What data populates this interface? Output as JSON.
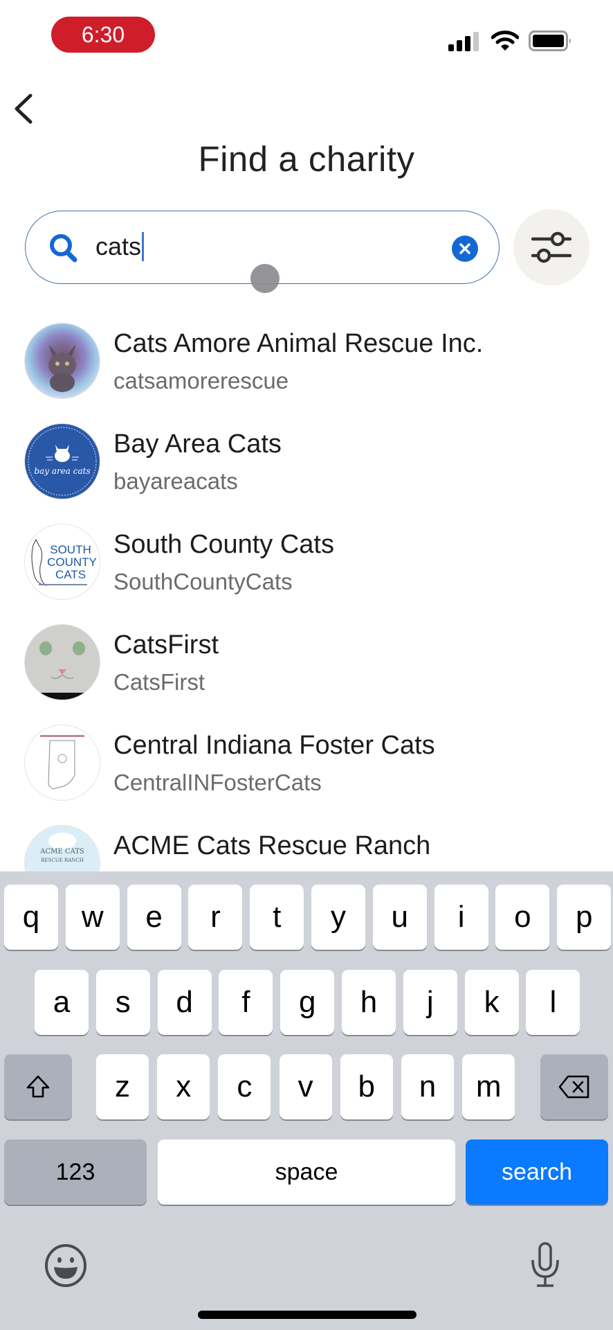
{
  "status_bar": {
    "time": "6:30",
    "time_pill_color": "#cf1d2a",
    "icons": [
      "cellular-signal-icon",
      "wifi-icon",
      "battery-icon"
    ]
  },
  "header": {
    "back_icon": "chevron-left-icon",
    "title": "Find a charity"
  },
  "search": {
    "value": "cats",
    "placeholder": "",
    "icon": "search-icon",
    "clear_icon": "clear-circle-icon",
    "accent_color": "#1468d4",
    "filter_icon": "sliders-icon"
  },
  "results": [
    {
      "name": "Cats Amore Animal Rescue Inc.",
      "handle": "catsamorerescue",
      "avatar": "kitten-photo"
    },
    {
      "name": "Bay Area Cats",
      "handle": "bayareacats",
      "avatar": "bay-area-cats-logo",
      "avatar_text": "bay area cats"
    },
    {
      "name": "South County Cats",
      "handle": "SouthCountyCats",
      "avatar": "south-county-cats-logo",
      "avatar_text": [
        "SOUTH",
        "COUNTY",
        "CATS"
      ]
    },
    {
      "name": "CatsFirst",
      "handle": "CatsFirst",
      "avatar": "white-cat-painting"
    },
    {
      "name": "Central Indiana Foster Cats",
      "handle": "CentralINFosterCats",
      "avatar": "indiana-map-logo"
    },
    {
      "name": "ACME Cats Rescue Ranch",
      "handle": "",
      "avatar": "acme-cats-logo",
      "avatar_text": [
        "ACME CATS",
        "RESCUE RANCH"
      ]
    }
  ],
  "keyboard": {
    "row1": [
      "q",
      "w",
      "e",
      "r",
      "t",
      "y",
      "u",
      "i",
      "o",
      "p"
    ],
    "row2": [
      "a",
      "s",
      "d",
      "f",
      "g",
      "h",
      "j",
      "k",
      "l"
    ],
    "row3": [
      "z",
      "x",
      "c",
      "v",
      "b",
      "n",
      "m"
    ],
    "shift_icon": "shift-icon",
    "delete_icon": "backspace-icon",
    "numbers_label": "123",
    "space_label": "space",
    "action_label": "search",
    "action_color": "#0b7afe",
    "emoji_icon": "emoji-icon",
    "mic_icon": "microphone-icon"
  }
}
